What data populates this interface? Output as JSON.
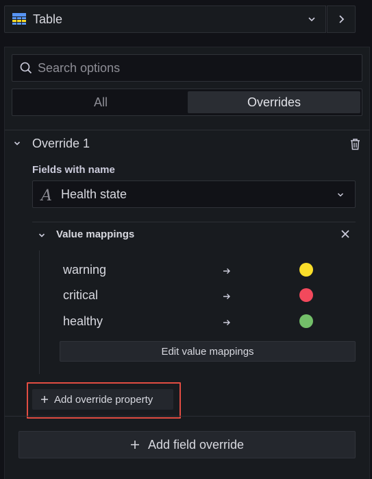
{
  "viz_picker": {
    "name": "Table",
    "icon": "table-icon"
  },
  "search": {
    "placeholder": "Search options",
    "value": ""
  },
  "tabs": [
    {
      "label": "All",
      "active": false
    },
    {
      "label": "Overrides",
      "active": true
    }
  ],
  "override": {
    "title": "Override 1",
    "matcher_label": "Fields with name",
    "matcher_value": "Health state",
    "property": {
      "title": "Value mappings",
      "mappings": [
        {
          "value": "warning",
          "color": "#fade2a"
        },
        {
          "value": "critical",
          "color": "#f2495c"
        },
        {
          "value": "healthy",
          "color": "#73bf69"
        }
      ],
      "edit_label": "Edit value mappings"
    },
    "add_property_label": "Add override property"
  },
  "add_field_override_label": "Add field override",
  "colors": {
    "highlight": "#e24d42",
    "background": "#111217",
    "panel": "#181b1f"
  }
}
